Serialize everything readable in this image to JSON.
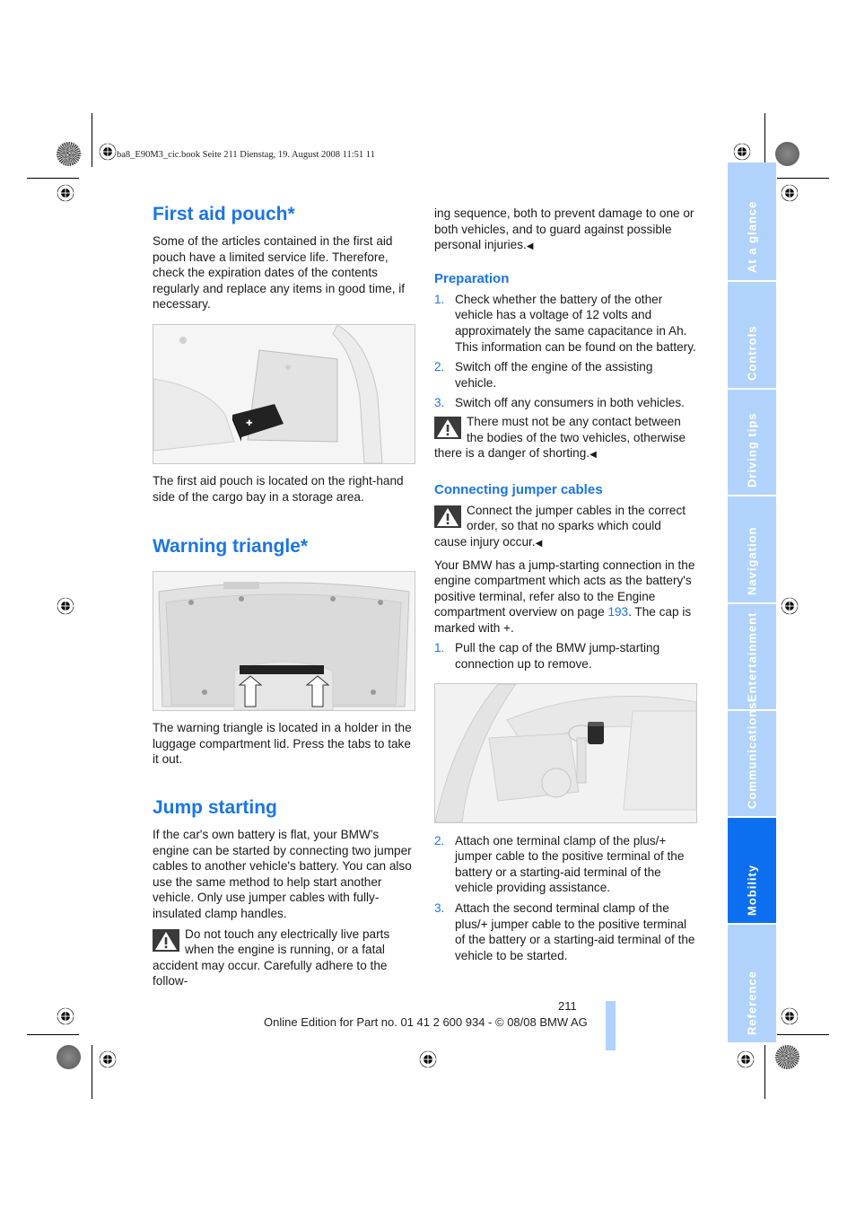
{
  "slug": "ba8_E90M3_cic.book  Seite 211  Dienstag, 19. August 2008  11:51 11",
  "left_column": {
    "first_aid": {
      "heading": "First aid pouch*",
      "intro": "Some of the articles contained in the first aid pouch have a limited service life. Therefore, check the expiration dates of the contents regularly and replace any items in good time, if necessary.",
      "figure_alt": "first-aid-pouch-in-cargo-bay-illustration",
      "caption": "The first aid pouch is located on the right-hand side of the cargo bay in a storage area."
    },
    "warning_triangle": {
      "heading": "Warning triangle*",
      "figure_alt": "warning-triangle-in-trunk-lid-illustration",
      "caption": "The warning triangle is located in a holder in the luggage compartment lid. Press the tabs to take it out."
    },
    "jump_starting": {
      "heading": "Jump starting",
      "intro": "If the car's own battery is flat, your BMW's engine can be started by connecting two jumper cables to another vehicle's battery. You can also use the same method to help start another vehicle. Only use jumper cables with fully-insulated clamp handles.",
      "warning": "Do not touch any electrically live parts when the engine is running, or a fatal accident may occur. Carefully adhere to the follow-"
    }
  },
  "right_column": {
    "continuation": "ing sequence, both to prevent damage to one or both vehicles, and to guard against possible personal injuries.",
    "end_mark": "◀",
    "preparation": {
      "heading": "Preparation",
      "steps": [
        {
          "num": "1.",
          "text": "Check whether the battery of the other vehicle has a voltage of 12 volts and approximately the same capacitance in Ah. This information can be found on the battery."
        },
        {
          "num": "2.",
          "text": "Switch off the engine of the assisting vehicle."
        },
        {
          "num": "3.",
          "text": "Switch off any consumers in both vehicles."
        }
      ],
      "warning": "There must not be any contact between the bodies of the two vehicles, otherwise there is a danger of shorting."
    },
    "connecting": {
      "heading": "Connecting jumper cables",
      "warning": "Connect the jumper cables in the correct order, so that no sparks which could cause injury occur.",
      "para_before_link": "Your BMW has a jump-starting connection in the engine compartment which acts as the battery's positive terminal, refer also to the Engine compartment overview on page ",
      "page_link": "193",
      "para_after_link": ". The cap is marked with +.",
      "steps": [
        {
          "num": "1.",
          "text": "Pull the cap of the BMW jump-starting connection up to remove."
        },
        {
          "num": "2.",
          "text": "Attach one terminal clamp of the plus/+ jumper cable to the positive terminal of the battery or a starting-aid terminal of the vehicle providing assistance."
        },
        {
          "num": "3.",
          "text": "Attach the second terminal clamp of the plus/+ jumper cable to the positive terminal of the battery or a starting-aid terminal of the vehicle to be started."
        }
      ],
      "figure_alt": "jump-start-terminal-engine-bay-illustration"
    }
  },
  "side_tabs": [
    {
      "label": "At a glance",
      "active": false
    },
    {
      "label": "Controls",
      "active": false
    },
    {
      "label": "Driving tips",
      "active": false
    },
    {
      "label": "Navigation",
      "active": false
    },
    {
      "label": "Entertainment",
      "active": false
    },
    {
      "label": "Communications",
      "active": false
    },
    {
      "label": "Mobility",
      "active": true
    },
    {
      "label": "Reference",
      "active": false
    }
  ],
  "footer": {
    "page_number": "211",
    "edition": "Online Edition for Part no. 01 41 2 600 934 - © 08/08 BMW AG"
  },
  "colors": {
    "accent": "#1a75e8",
    "tab_inactive": "#b1d3fb",
    "tab_active": "#0c6ff0"
  }
}
